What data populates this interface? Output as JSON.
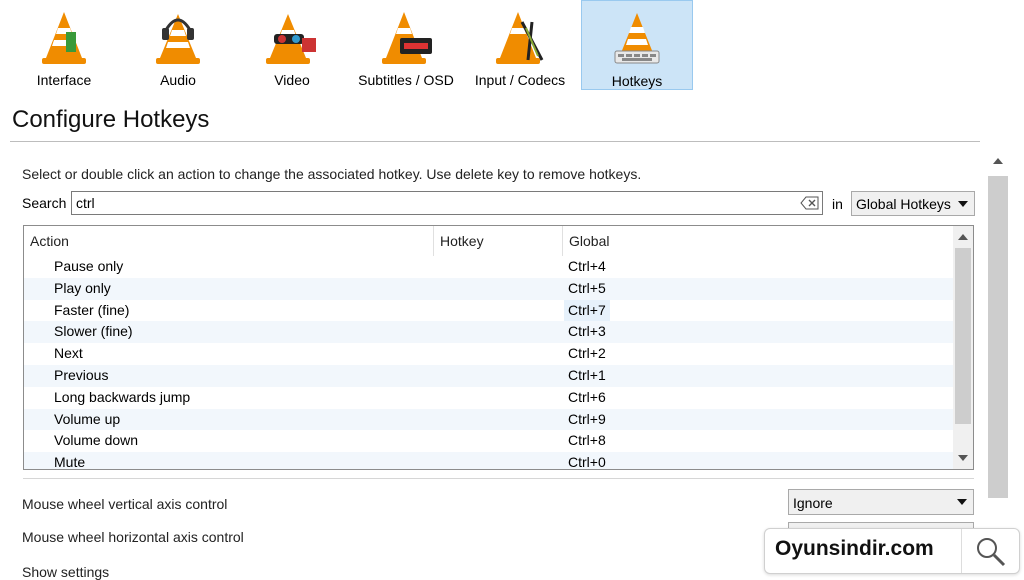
{
  "categories": [
    {
      "label": "Interface",
      "icon": "interface-icon",
      "active": false
    },
    {
      "label": "Audio",
      "icon": "audio-icon",
      "active": false
    },
    {
      "label": "Video",
      "icon": "video-icon",
      "active": false
    },
    {
      "label": "Subtitles / OSD",
      "icon": "subtitles-icon",
      "active": false
    },
    {
      "label": "Input / Codecs",
      "icon": "input-codecs-icon",
      "active": false
    },
    {
      "label": "Hotkeys",
      "icon": "hotkeys-icon",
      "active": true
    }
  ],
  "page": {
    "title": "Configure Hotkeys",
    "instructions": "Select or double click an action to change the associated hotkey. Use delete key to remove hotkeys."
  },
  "search": {
    "label": "Search",
    "value": "ctrl",
    "in_label": "in",
    "scope": "Global Hotkeys"
  },
  "table": {
    "headers": {
      "action": "Action",
      "hotkey": "Hotkey",
      "global": "Global"
    },
    "rows": [
      {
        "action": "Pause only",
        "hotkey": "",
        "global": "Ctrl+4"
      },
      {
        "action": "Play only",
        "hotkey": "",
        "global": "Ctrl+5"
      },
      {
        "action": "Faster (fine)",
        "hotkey": "",
        "global": "Ctrl+7"
      },
      {
        "action": "Slower (fine)",
        "hotkey": "",
        "global": "Ctrl+3"
      },
      {
        "action": "Next",
        "hotkey": "",
        "global": "Ctrl+2"
      },
      {
        "action": "Previous",
        "hotkey": "",
        "global": "Ctrl+1"
      },
      {
        "action": "Long backwards jump",
        "hotkey": "",
        "global": "Ctrl+6"
      },
      {
        "action": "Volume up",
        "hotkey": "",
        "global": "Ctrl+9"
      },
      {
        "action": "Volume down",
        "hotkey": "",
        "global": "Ctrl+8"
      },
      {
        "action": "Mute",
        "hotkey": "",
        "global": "Ctrl+0"
      }
    ]
  },
  "mouse": {
    "vertical_label": "Mouse wheel vertical axis control",
    "vertical_value": "Ignore",
    "horizontal_label": "Mouse wheel horizontal axis control",
    "horizontal_value": ""
  },
  "footer": {
    "show_settings": "Show settings"
  },
  "watermark": {
    "text": "Oyunsindir.com"
  },
  "colors": {
    "accent": "#cce4f7",
    "cone_orange": "#f08c00",
    "selection": "#e6f1fb"
  }
}
